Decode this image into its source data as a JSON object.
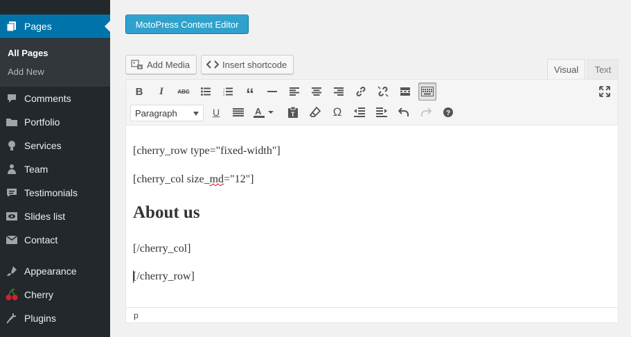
{
  "sidebar": {
    "items": [
      {
        "label": "Pages",
        "icon": "pages-icon"
      },
      {
        "label": "Comments",
        "icon": "comments-icon"
      },
      {
        "label": "Portfolio",
        "icon": "portfolio-icon"
      },
      {
        "label": "Services",
        "icon": "services-icon"
      },
      {
        "label": "Team",
        "icon": "team-icon"
      },
      {
        "label": "Testimonials",
        "icon": "testimonials-icon"
      },
      {
        "label": "Slides list",
        "icon": "slides-icon"
      },
      {
        "label": "Contact",
        "icon": "contact-icon"
      },
      {
        "label": "Appearance",
        "icon": "appearance-icon"
      },
      {
        "label": "Cherry",
        "icon": "cherry-icon"
      },
      {
        "label": "Plugins",
        "icon": "plugins-icon"
      }
    ],
    "submenu": [
      "All Pages",
      "Add New"
    ]
  },
  "editor": {
    "motopress_label": "MotoPress Content Editor",
    "add_media_label": "Add Media",
    "insert_shortcode_label": "Insert shortcode",
    "tab_visual": "Visual",
    "tab_text": "Text",
    "format_value": "Paragraph",
    "content": {
      "line1": "[cherry_row type=\"fixed-width\"]",
      "line2_a": "[cherry_col size_",
      "line2_b": "md",
      "line2_c": "=\"12\"]",
      "heading": "About us",
      "line3": "[/cherry_col]",
      "line4": "[/cherry_row]"
    },
    "status_path": "p"
  },
  "colors": {
    "sidebar_bg": "#23282d",
    "submenu_bg": "#32373c",
    "accent": "#0073aa",
    "motopress_btn": "#2ea2cc"
  }
}
